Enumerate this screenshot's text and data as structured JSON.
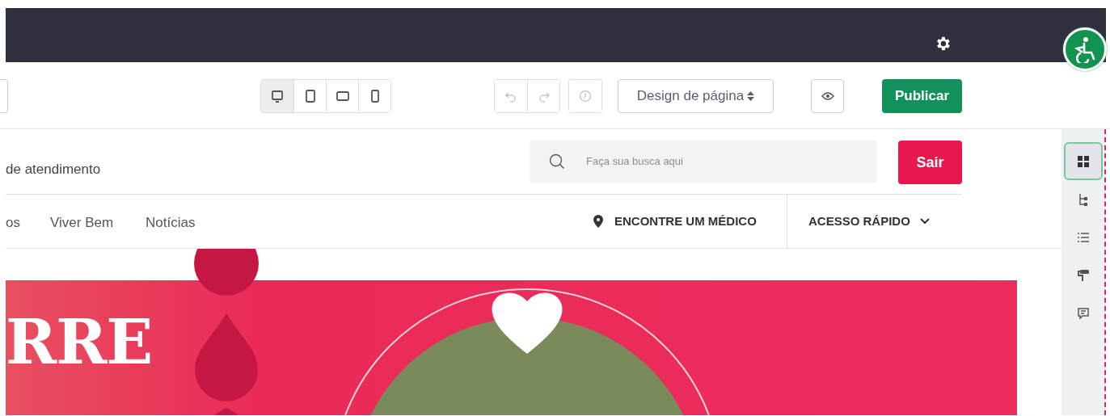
{
  "toolbar": {
    "device_buttons": [
      {
        "kind": "desktop",
        "selected": true
      },
      {
        "kind": "tablet",
        "selected": false
      },
      {
        "kind": "landscape",
        "selected": false
      },
      {
        "kind": "phone",
        "selected": false
      }
    ],
    "history_buttons": [
      {
        "kind": "undo",
        "disabled": true
      },
      {
        "kind": "redo",
        "disabled": true
      },
      {
        "kind": "history",
        "disabled": true
      }
    ],
    "layout_dropdown": {
      "label": "Design de página"
    },
    "publish_button": {
      "label": "Publicar"
    }
  },
  "site_header": {
    "text": "de atendimento",
    "search": {
      "placeholder": "Faça sua busca aqui"
    },
    "logout_button": "Sair"
  },
  "site_nav": {
    "items": [
      "os",
      "Viver Bem",
      "Notícias"
    ],
    "find_doctor": "ENCONTRE UM MÉDICO",
    "quick_access": "ACESSO RÁPIDO"
  },
  "banner": {
    "headline": "RRE"
  },
  "sidebar": {
    "tools": [
      {
        "kind": "blocks",
        "selected": true
      },
      {
        "kind": "tree",
        "selected": false
      },
      {
        "kind": "list",
        "selected": false
      },
      {
        "kind": "paint",
        "selected": false
      },
      {
        "kind": "comments",
        "selected": false
      }
    ]
  }
}
